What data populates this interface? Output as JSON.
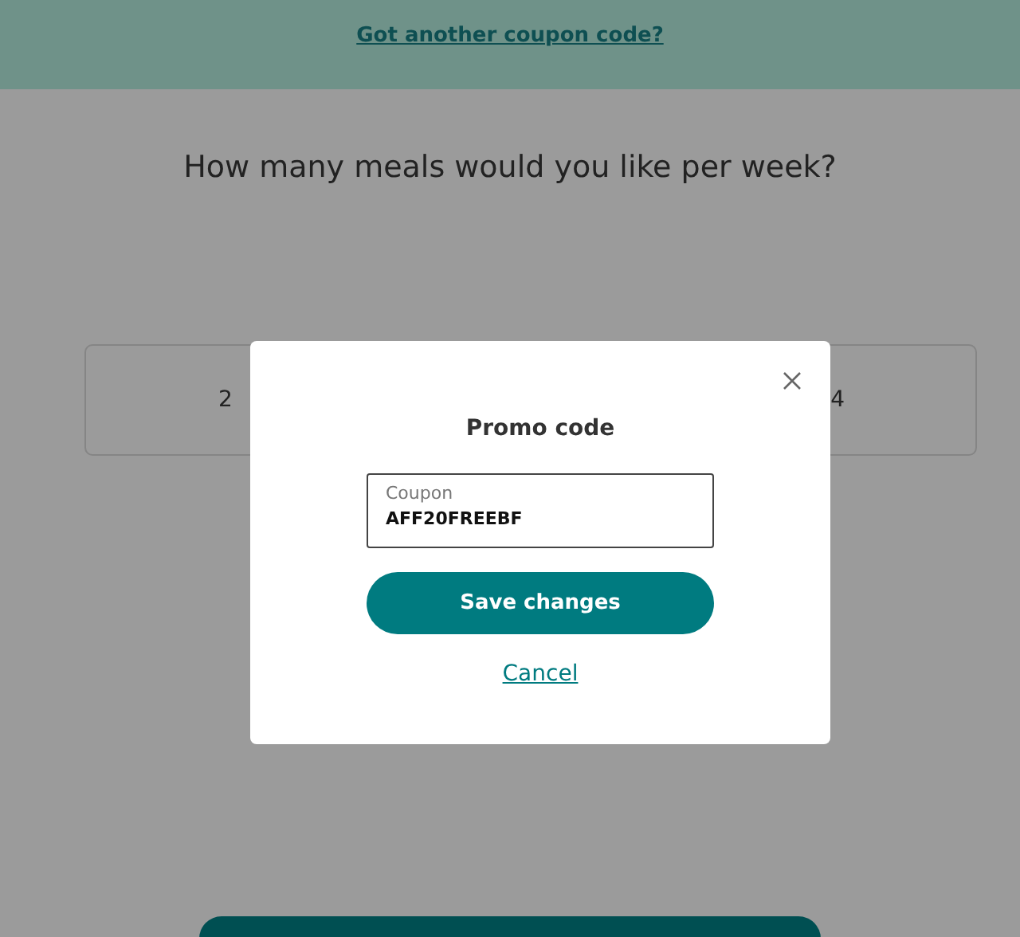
{
  "banner": {
    "link": "Got another coupon code?"
  },
  "question": "How many meals would you like per week?",
  "options": [
    {
      "label": "2"
    },
    {
      "label": "4"
    }
  ],
  "modal": {
    "title": "Promo code",
    "field": {
      "label": "Coupon",
      "value": "AFF20FREEBF"
    },
    "save_button": "Save changes",
    "cancel_link": "Cancel"
  }
}
